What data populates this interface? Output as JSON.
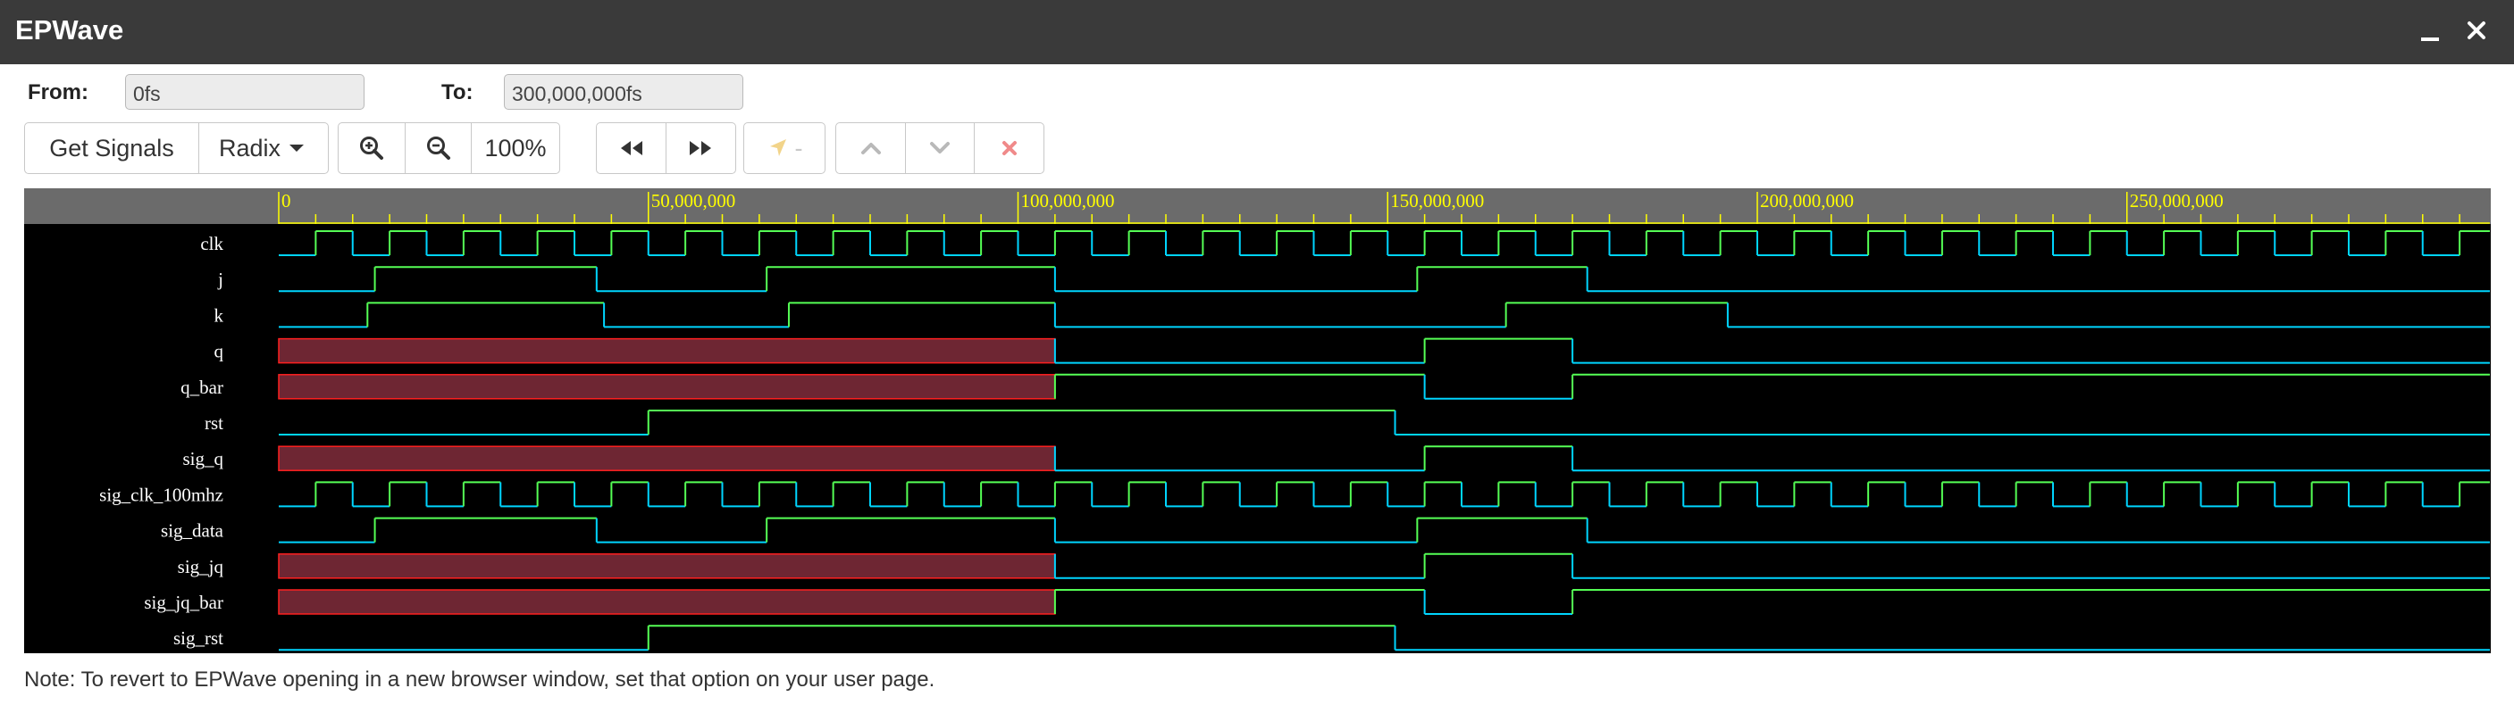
{
  "window": {
    "title": "EPWave",
    "minimize_icon": "minimize-icon",
    "close_icon": "close-icon"
  },
  "range": {
    "from_label": "From:",
    "from_value": "0fs",
    "to_label": "To:",
    "to_value": "300,000,000fs"
  },
  "toolbar": {
    "get_signals": "Get Signals",
    "radix": "Radix",
    "zoom_in_icon": "zoom-in-icon",
    "zoom_out_icon": "zoom-out-icon",
    "zoom_level": "100%",
    "prev_edge_icon": "rewind-icon",
    "next_edge_icon": "fast-forward-icon",
    "marker_icon": "marker-icon",
    "marker_value": "-",
    "move_up_icon": "chevron-up-icon",
    "move_down_icon": "chevron-down-icon",
    "remove_icon": "remove-icon"
  },
  "waveform": {
    "time_range": [
      0,
      300000000
    ],
    "ticks": [
      {
        "t": 0,
        "label": "0"
      },
      {
        "t": 50000000,
        "label": "50,000,000"
      },
      {
        "t": 100000000,
        "label": "100,000,000"
      },
      {
        "t": 150000000,
        "label": "150,000,000"
      },
      {
        "t": 200000000,
        "label": "200,000,000"
      },
      {
        "t": 250000000,
        "label": "250,000,000"
      }
    ],
    "colors": {
      "background": "#000000",
      "ruler": "#6b6b6b",
      "tick_text": "#ffff00",
      "low": "#00d5ff",
      "high": "#55ff55",
      "unknown_fill": "#6e2633",
      "unknown_stroke": "#ff2020",
      "label": "#ffffff"
    },
    "signals": [
      {
        "name": "clk",
        "kind": "clock",
        "period": 10000000,
        "phase": 5000000
      },
      {
        "name": "j",
        "kind": "bit",
        "init": 0,
        "changes": [
          [
            13000000,
            1
          ],
          [
            43000000,
            0
          ],
          [
            66000000,
            1
          ],
          [
            105000000,
            0
          ],
          [
            154000000,
            1
          ],
          [
            177000000,
            0
          ]
        ]
      },
      {
        "name": "k",
        "kind": "bit",
        "init": 0,
        "changes": [
          [
            12000000,
            1
          ],
          [
            44000000,
            0
          ],
          [
            69000000,
            1
          ],
          [
            105000000,
            0
          ],
          [
            166000000,
            1
          ],
          [
            196000000,
            0
          ]
        ]
      },
      {
        "name": "q",
        "kind": "bit",
        "init": "x",
        "changes": [
          [
            105000000,
            0
          ],
          [
            155000000,
            1
          ],
          [
            175000000,
            0
          ]
        ]
      },
      {
        "name": "q_bar",
        "kind": "bit",
        "init": "x",
        "changes": [
          [
            105000000,
            1
          ],
          [
            155000000,
            0
          ],
          [
            175000000,
            1
          ]
        ]
      },
      {
        "name": "rst",
        "kind": "bit",
        "init": 0,
        "changes": [
          [
            50000000,
            1
          ],
          [
            151000000,
            0
          ]
        ]
      },
      {
        "name": "sig_q",
        "kind": "bit",
        "init": "x",
        "changes": [
          [
            105000000,
            0
          ],
          [
            155000000,
            1
          ],
          [
            175000000,
            0
          ]
        ]
      },
      {
        "name": "sig_clk_100mhz",
        "kind": "clock",
        "period": 10000000,
        "phase": 5000000
      },
      {
        "name": "sig_data",
        "kind": "bit",
        "init": 0,
        "changes": [
          [
            13000000,
            1
          ],
          [
            43000000,
            0
          ],
          [
            66000000,
            1
          ],
          [
            105000000,
            0
          ],
          [
            154000000,
            1
          ],
          [
            177000000,
            0
          ]
        ]
      },
      {
        "name": "sig_jq",
        "kind": "bit",
        "init": "x",
        "changes": [
          [
            105000000,
            0
          ],
          [
            155000000,
            1
          ],
          [
            175000000,
            0
          ]
        ]
      },
      {
        "name": "sig_jq_bar",
        "kind": "bit",
        "init": "x",
        "changes": [
          [
            105000000,
            1
          ],
          [
            155000000,
            0
          ],
          [
            175000000,
            1
          ]
        ]
      },
      {
        "name": "sig_rst",
        "kind": "bit",
        "init": 0,
        "changes": [
          [
            50000000,
            1
          ],
          [
            151000000,
            0
          ]
        ]
      }
    ]
  },
  "note": "Note: To revert to EPWave opening in a new browser window, set that option on your user page."
}
